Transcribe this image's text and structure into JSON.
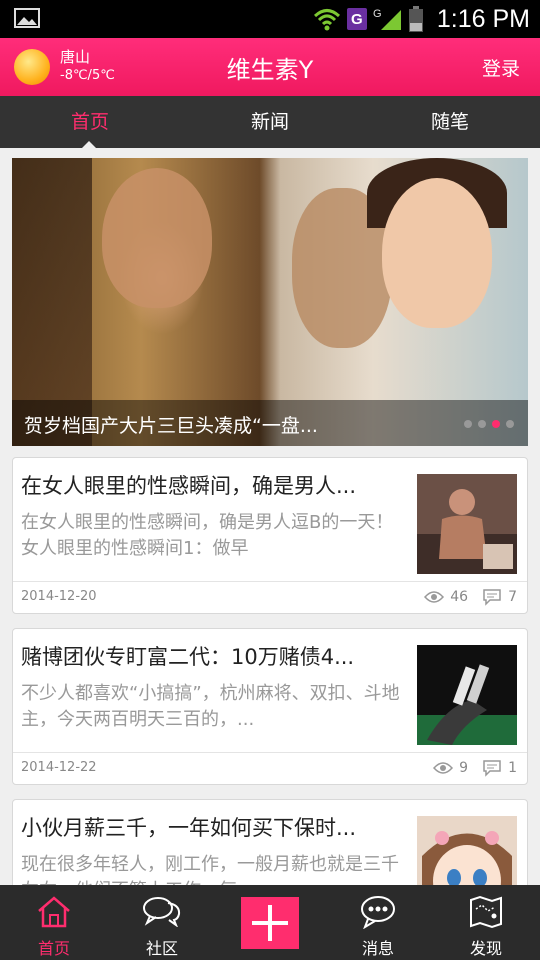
{
  "status_bar": {
    "time": "1:16 PM",
    "carrier_badge": "G",
    "network_label": "G",
    "icons": [
      "image-icon",
      "wifi-icon",
      "signal-icon",
      "battery-icon"
    ]
  },
  "header": {
    "weather": {
      "city": "唐山",
      "temp": "-8℃/5℃",
      "icon": "sun-icon"
    },
    "title": "维生素Y",
    "login_label": "登录"
  },
  "tabs": [
    {
      "label": "首页",
      "active": true
    },
    {
      "label": "新闻",
      "active": false
    },
    {
      "label": "随笔",
      "active": false
    }
  ],
  "banner": {
    "caption": "贺岁档国产大片三巨头凑成“一盘...",
    "dots": 4,
    "active_dot": 2
  },
  "articles": [
    {
      "title": "在女人眼里的性感瞬间，确是男人...",
      "summary": "在女人眼里的性感瞬间，确是男人逗B的一天！　  女人眼里的性感瞬间1：做早",
      "date": "2014-12-20",
      "views": "46",
      "comments": "7"
    },
    {
      "title": "赌博团伙专盯富二代：10万赌债4...",
      "summary": "不少人都喜欢“小搞搞”，杭州麻将、双扣、斗地主，今天两百明天三百的，...",
      "date": "2014-12-22",
      "views": "9",
      "comments": "1"
    },
    {
      "title": "小伙月薪三千，一年如何买下保时...",
      "summary": "现在很多年轻人，刚工作，一般月薪也就是三千左右，他们不管上工作，每",
      "date": "",
      "views": "",
      "comments": ""
    }
  ],
  "bottom_nav": [
    {
      "label": "首页",
      "icon": "home-icon",
      "active": true
    },
    {
      "label": "社区",
      "icon": "chat-bubbles-icon",
      "active": false
    },
    {
      "label": "",
      "icon": "plus-icon",
      "active": false
    },
    {
      "label": "消息",
      "icon": "message-icon",
      "active": false
    },
    {
      "label": "发现",
      "icon": "discover-icon",
      "active": false
    }
  ],
  "colors": {
    "accent": "#ff2d6e",
    "header": "#f0195f",
    "tabbar": "#333333",
    "navbar": "#2b2b2b"
  }
}
